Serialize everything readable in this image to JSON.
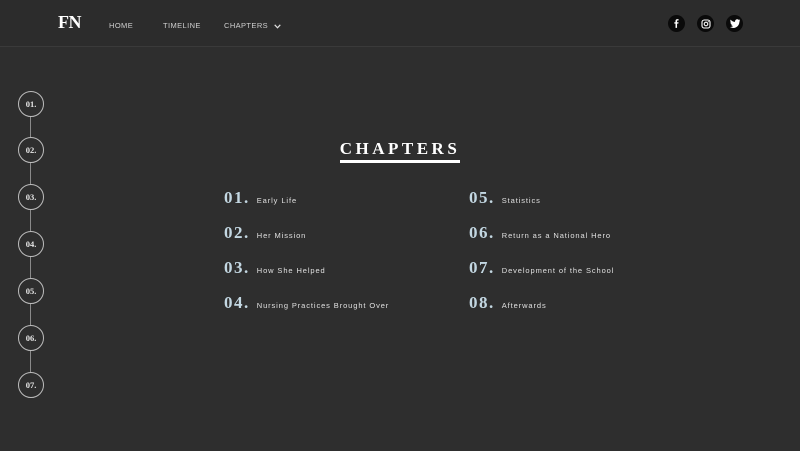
{
  "header": {
    "logo": "FN",
    "nav": [
      {
        "label": "HOME"
      },
      {
        "label": "TIMELINE"
      },
      {
        "label": "CHAPTERS"
      }
    ],
    "social": [
      "facebook-icon",
      "instagram-icon",
      "twitter-icon"
    ]
  },
  "timeline": [
    "01.",
    "02.",
    "03.",
    "04.",
    "05.",
    "06.",
    "07."
  ],
  "main": {
    "title": "CHAPTERS",
    "chapters": [
      {
        "num": "01.",
        "label": "Early Life"
      },
      {
        "num": "02.",
        "label": "Her Mission"
      },
      {
        "num": "03.",
        "label": "How She Helped"
      },
      {
        "num": "04.",
        "label": "Nursing Practices Brought Over"
      },
      {
        "num": "05.",
        "label": "Statistics"
      },
      {
        "num": "06.",
        "label": "Return as a National Hero"
      },
      {
        "num": "07.",
        "label": "Development of the School"
      },
      {
        "num": "08.",
        "label": "Afterwards"
      }
    ]
  },
  "colors": {
    "background": "#2e2e2e",
    "chapter_number": "#c3d7e2",
    "text": "#e8e8e8"
  }
}
